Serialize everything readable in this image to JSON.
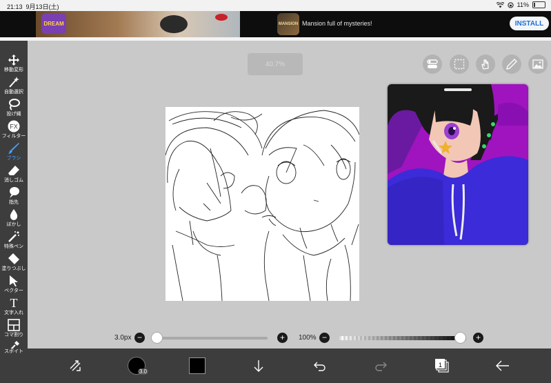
{
  "status": {
    "time": "21:13",
    "date": "9月13日(土)",
    "battery": "11%",
    "battery_level": 0.11
  },
  "ad": {
    "logo_text": "DREAM",
    "app_icon_text": "MANSION",
    "text": "Mansion full of mysteries!",
    "install_label": "INSTALL"
  },
  "toolbar": {
    "active": "brush",
    "items": [
      {
        "id": "move",
        "label": "移動変形",
        "icon": "move-icon"
      },
      {
        "id": "auto-select",
        "label": "自動選択",
        "icon": "magic-wand-icon"
      },
      {
        "id": "lasso",
        "label": "投げ縄",
        "icon": "lasso-icon"
      },
      {
        "id": "filter",
        "label": "フィルター",
        "icon": "fx-icon",
        "icon_text": "FX"
      },
      {
        "id": "brush",
        "label": "ブラシ",
        "icon": "brush-icon"
      },
      {
        "id": "eraser",
        "label": "消しゴム",
        "icon": "eraser-icon"
      },
      {
        "id": "finger",
        "label": "指先",
        "icon": "finger-icon"
      },
      {
        "id": "blur",
        "label": "ぼかし",
        "icon": "droplet-icon"
      },
      {
        "id": "special-pen",
        "label": "特殊ペン",
        "icon": "special-pen-icon"
      },
      {
        "id": "fill",
        "label": "塗りつぶし",
        "icon": "bucket-icon"
      },
      {
        "id": "vector",
        "label": "ベクター",
        "icon": "vector-arrow-icon"
      },
      {
        "id": "text",
        "label": "文字入れ",
        "icon": "text-icon",
        "icon_text": "T"
      },
      {
        "id": "frame",
        "label": "コマ割り",
        "icon": "frame-divide-icon"
      },
      {
        "id": "eyedropper",
        "label": "スポイト",
        "icon": "eyedropper-icon"
      }
    ]
  },
  "zoom": "40.7%",
  "top_icons": [
    "toggle-icon",
    "selection-icon",
    "hand-icon",
    "pen-icon",
    "image-icon"
  ],
  "brush_size": {
    "label": "3.0px",
    "minus": "−",
    "plus": "+",
    "level": 0.02
  },
  "opacity": {
    "label": "100%",
    "minus": "−",
    "plus": "+",
    "level": 1.0
  },
  "bottom": {
    "brush_size_badge": "3.0",
    "color": "#000000",
    "page_number": "1"
  }
}
